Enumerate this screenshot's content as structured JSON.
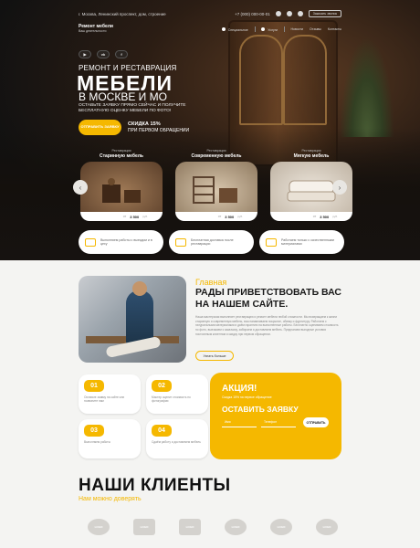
{
  "topbar": {
    "address": "г. Москва, Ленинский проспект, дом, строение",
    "phone": "+7 (000) 000-00-01",
    "callback_label": "Заказать звонок"
  },
  "header": {
    "logo_title": "Ремонт мебели",
    "logo_subtitle": "Ваш деятельности",
    "nav": [
      {
        "label": "Специальное"
      },
      {
        "label": "Услуги"
      },
      {
        "label": "Новости"
      },
      {
        "label": "Отзывы"
      },
      {
        "label": "Контакты"
      }
    ]
  },
  "social": [
    {
      "label": "▶",
      "icon": "youtube-icon"
    },
    {
      "label": "vk",
      "icon": "vk-icon"
    },
    {
      "label": "f",
      "icon": "facebook-icon"
    }
  ],
  "hero": {
    "subtitle": "РЕМОНТ И РЕСТАВРАЦИЯ",
    "title": "МЕБЕЛИ",
    "title_sub": "В МОСКВЕ И МО",
    "description": "ОСТАВЬТЕ ЗАЯВКУ ПРЯМО СЕЙЧАС И ПОЛУЧИТЕ БЕСПЛАТНУЮ ОЦЕНКУ МЕБЕЛИ ПО ФОТО!",
    "button_label": "ОТПРАВИТЬ ЗАЯВКУ",
    "discount_title": "СКИДКА 15%",
    "discount_text": "ПРИ ПЕРВОМ ОБРАЩЕНИИ"
  },
  "categories": [
    {
      "kicker": "Реставрация",
      "title": "Старинную мебель",
      "from": "от",
      "price": "3 500",
      "currency": "руб."
    },
    {
      "kicker": "Реставрация",
      "title": "Современную мебель",
      "from": "от",
      "price": "3 500",
      "currency": "руб."
    },
    {
      "kicker": "Реставрация",
      "title": "Мягкую мебель",
      "from": "от",
      "price": "3 500",
      "currency": "руб."
    }
  ],
  "features": [
    {
      "text": "Выполняем работы с выездом и в цеху"
    },
    {
      "text": "Бесплатная доставка после реставрации"
    },
    {
      "text": "Работаем только с качественными материалами"
    }
  ],
  "about": {
    "kicker": "Главная",
    "title": "РАДЫ ПРИВЕТСТВОВАТЬ ВАС НА НАШЕМ САЙТЕ.",
    "text": "Наша мастерская выполняет реставрацию и ремонт мебели любой сложности. Мы возвращаем к жизни старинную и современную мебель, восстанавливаем покрытие, обивку и фурнитуру. Работаем с натуральными материалами и даём гарантию на выполненные работы. Бесплатно оцениваем стоимость по фото, выезжаем к заказчику, забираем и доставляем мебель. Предлагаем выгодные условия постоянным клиентам и скидку при первом обращении.",
    "button_label": "Узнать больше"
  },
  "steps": [
    {
      "num": "01",
      "text": "Оставьте заявку на сайте или позвоните нам"
    },
    {
      "num": "02",
      "text": "Мастер оценит стоимость по фотографии"
    },
    {
      "num": "03",
      "text": "Выполняем работы"
    },
    {
      "num": "04",
      "text": "Сдаём работу и доставляем мебель"
    }
  ],
  "promo": {
    "title": "АКЦИЯ!",
    "subtitle": "Скидка 15% на первое обращение",
    "cta": "ОСТАВИТЬ ЗАЯВКУ",
    "name_placeholder": "Имя",
    "phone_placeholder": "Телефон",
    "button_label": "ОТПРАВИТЬ"
  },
  "clients": {
    "title": "НАШИ КЛИЕНТЫ",
    "subtitle": "Нам можно доверять",
    "logos": [
      "LOGO",
      "LOGO",
      "LOGO",
      "LOGO",
      "LOGO",
      "LOGO"
    ]
  },
  "colors": {
    "accent": "#f5b800",
    "dark": "#161210",
    "light_bg": "#f4f4f2"
  }
}
